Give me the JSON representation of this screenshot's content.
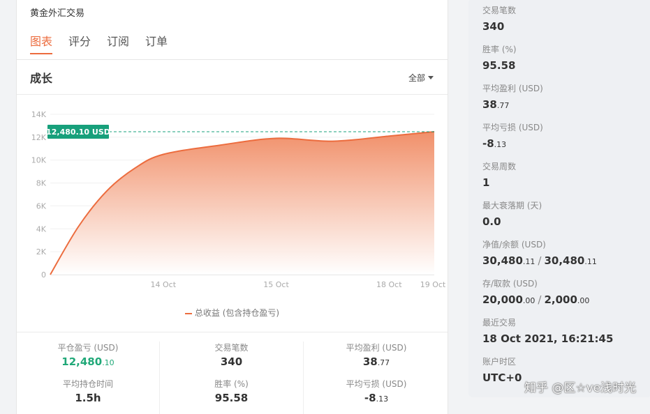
{
  "strategy": {
    "title": "黄金外汇交易"
  },
  "tabs": [
    {
      "label": "图表",
      "active": true
    },
    {
      "label": "评分",
      "active": false
    },
    {
      "label": "订阅",
      "active": false
    },
    {
      "label": "订单",
      "active": false
    }
  ],
  "growth": {
    "title": "成长",
    "range_label": "全部"
  },
  "chart_data": {
    "type": "area",
    "title": "",
    "xlabel": "",
    "ylabel": "",
    "x_ticks": [
      "14 Oct",
      "15 Oct",
      "18 Oct",
      "19 Oct"
    ],
    "y_ticks": [
      "0",
      "2K",
      "4K",
      "6K",
      "8K",
      "10K",
      "12K",
      "14K"
    ],
    "ylim": [
      0,
      14000
    ],
    "series": [
      {
        "name": "总收益 (包含持仓盈亏)",
        "color": "#ec6c3e",
        "points": [
          {
            "x": 0.0,
            "y": 0
          },
          {
            "x": 0.25,
            "y": 4200
          },
          {
            "x": 0.5,
            "y": 7300
          },
          {
            "x": 0.75,
            "y": 9300
          },
          {
            "x": 1.0,
            "y": 10500
          },
          {
            "x": 1.5,
            "y": 11300
          },
          {
            "x": 2.0,
            "y": 11900
          },
          {
            "x": 2.5,
            "y": 11650
          },
          {
            "x": 3.0,
            "y": 12100
          },
          {
            "x": 3.4,
            "y": 12480.1
          }
        ]
      }
    ],
    "reference_line": {
      "value": 12480.1,
      "label": "12,480.10 USD",
      "color": "#17a07b"
    },
    "grid": true,
    "legend_position": "bottom"
  },
  "legend_label": "总收益 (包含持仓盈亏)",
  "stats": [
    {
      "label": "平仓盈亏 (USD)",
      "value": "12,480",
      "decimals": ".10",
      "green": true
    },
    {
      "label": "交易笔数",
      "value": "340",
      "decimals": "",
      "green": false
    },
    {
      "label": "平均盈利 (USD)",
      "value": "38",
      "decimals": ".77",
      "green": false
    },
    {
      "label": "平均持仓时间",
      "value": "1.5h",
      "decimals": "",
      "green": false
    },
    {
      "label": "胜率 (%)",
      "value": "95.58",
      "decimals": "",
      "green": false
    },
    {
      "label": "平均亏损 (USD)",
      "value": "-8",
      "decimals": ".13",
      "green": false
    }
  ],
  "side": {
    "trades": {
      "label": "交易笔数",
      "value": "340"
    },
    "win_rate": {
      "label": "胜率 (%)",
      "value": "95.58"
    },
    "avg_profit": {
      "label": "平均盈利 (USD)",
      "value": "38",
      "dec": ".77"
    },
    "avg_loss": {
      "label": "平均亏损 (USD)",
      "value": "-8",
      "dec": ".13"
    },
    "trade_weeks": {
      "label": "交易周数",
      "value": "1"
    },
    "max_drawdown": {
      "label": "最大衰落期 (天)",
      "value": "0.0"
    },
    "equity": {
      "label": "净值/余额 (USD)",
      "v1": "30,480",
      "d1": ".11",
      "sep": "/",
      "v2": "30,480",
      "d2": ".11"
    },
    "deposit": {
      "label": "存/取款 (USD)",
      "v1": "20,000",
      "d1": ".00",
      "sep": "/",
      "v2": "2,000",
      "d2": ".00"
    },
    "last_trade": {
      "label": "最近交易",
      "value": "18 Oct 2021, 16:21:45"
    },
    "timezone": {
      "label": "账户时区",
      "value": "UTC+0"
    }
  },
  "watermark": "知乎 @区☆ve浅时光"
}
